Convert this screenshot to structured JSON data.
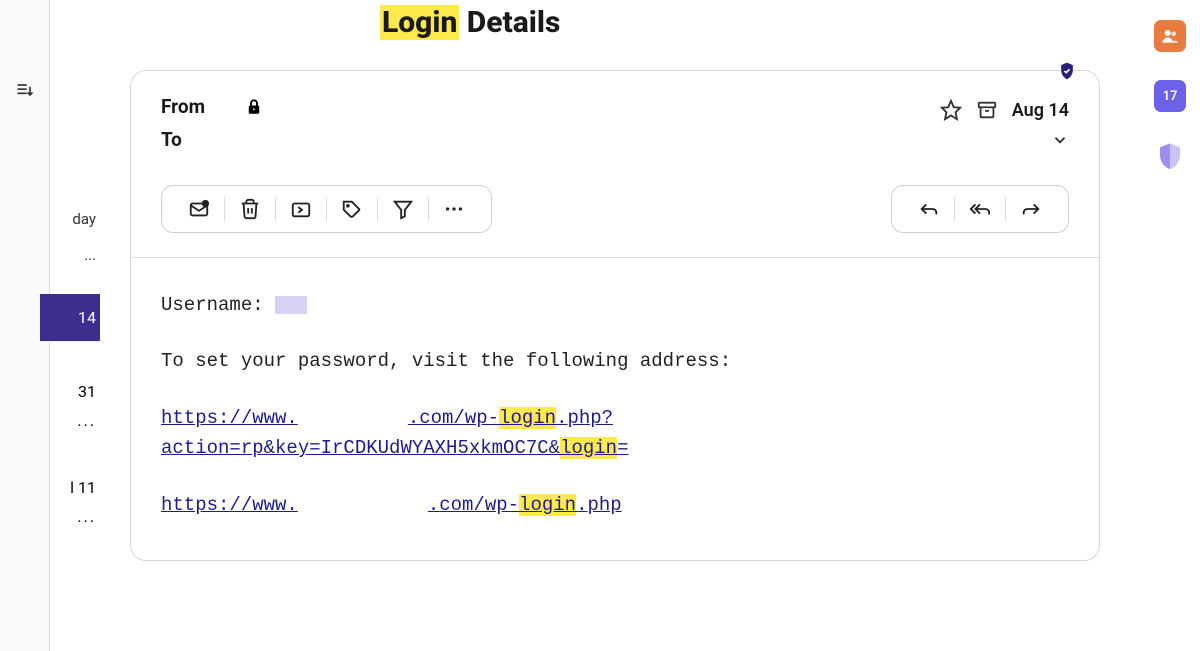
{
  "title": {
    "highlighted": "Login",
    "rest": " Details"
  },
  "sidebar": {
    "date1_label": "day",
    "item1_date": "14",
    "prefix1": "",
    "prefix3": "l",
    "date2_label": "31",
    "date3_label": "11",
    "ellipsis": "..."
  },
  "header": {
    "from": "From",
    "to": "To",
    "date": "Aug 14"
  },
  "body": {
    "username_label": "Username: ",
    "instruction": "To set your password, visit the following address:",
    "link1a": "https://www.",
    "link1b": ".com/wp-",
    "link1c": "login",
    "link1d": ".php?",
    "link2a": "action=rp&key=IrCDKUdWYAXH5xkmOC7C&",
    "link2b": "login",
    "link2c": "=",
    "link3a": "https://www.",
    "link3b": ".com/wp-",
    "link3c": "login",
    "link3d": ".php"
  },
  "apps": {
    "calendar_day": "17"
  }
}
